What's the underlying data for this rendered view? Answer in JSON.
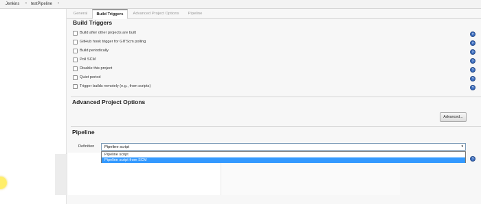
{
  "breadcrumb": {
    "items": [
      "Jenkins",
      "testPipeline"
    ],
    "separator": "›"
  },
  "tabs": [
    "General",
    "Build Triggers",
    "Advanced Project Options",
    "Pipeline"
  ],
  "active_tab": "Build Triggers",
  "build_triggers": {
    "title": "Build Triggers",
    "options": [
      {
        "label": "Build after other projects are built",
        "checked": false
      },
      {
        "label": "GitHub hook trigger for GITScm polling",
        "checked": false
      },
      {
        "label": "Build periodically",
        "checked": false
      },
      {
        "label": "Poll SCM",
        "checked": false
      },
      {
        "label": "Disable this project",
        "checked": false
      },
      {
        "label": "Quiet period",
        "checked": false
      },
      {
        "label": "Trigger builds remotely (e.g., from scripts)",
        "checked": false
      }
    ]
  },
  "advanced_options": {
    "title": "Advanced Project Options",
    "button_label": "Advanced..."
  },
  "pipeline": {
    "title": "Pipeline",
    "definition_label": "Definition",
    "selected": "Pipeline script",
    "dropdown_options": [
      "Pipeline script",
      "Pipeline script from SCM"
    ],
    "highlighted_option": "Pipeline script from SCM"
  },
  "help_icon_glyph": "?",
  "dropdown_arrow_glyph": "▾",
  "colors": {
    "help_icon": "#3b6dbf",
    "dropdown_highlight": "#3399ff",
    "panel_background": "#f7f7f7"
  }
}
